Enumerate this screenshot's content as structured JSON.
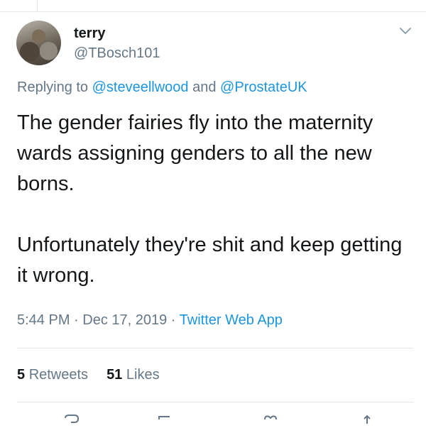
{
  "user": {
    "display_name": "terry",
    "handle": "@TBosch101"
  },
  "reply": {
    "prefix": "Replying to ",
    "mention1": "@steveellwood",
    "connector": " and ",
    "mention2": "@ProstateUK"
  },
  "tweet": {
    "paragraph1": "The gender fairies fly into the maternity wards assigning genders to all the new borns.",
    "paragraph2": "Unfortunately they're shit and keep getting it wrong."
  },
  "meta": {
    "time": "5:44 PM",
    "sep1": " · ",
    "date": "Dec 17, 2019",
    "sep2": " · ",
    "source": "Twitter Web App"
  },
  "stats": {
    "retweets_count": "5",
    "retweets_label": "Retweets",
    "likes_count": "51",
    "likes_label": "Likes"
  },
  "icons": {
    "menu": "chevron-down-icon",
    "actions": [
      "reply-icon",
      "retweet-icon",
      "like-icon",
      "share-icon"
    ]
  },
  "colors": {
    "link": "#1b95e0",
    "secondary_text": "#657786",
    "primary_text": "#14171a",
    "divider": "#e1e8ed"
  }
}
